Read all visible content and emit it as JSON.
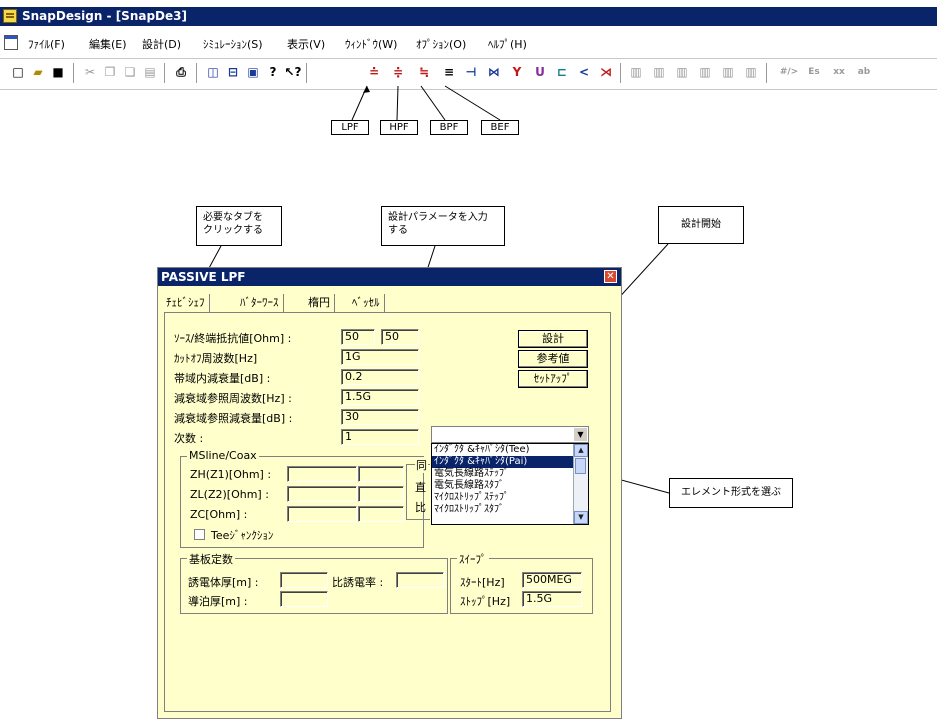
{
  "window": {
    "title": "SnapDesign - [SnapDe3]"
  },
  "menu": [
    "ﾌｧｲﾙ(F)",
    "編集(E)",
    "設計(D)",
    "ｼﾐｭﾚｰｼｮﾝ(S)",
    "表示(V)",
    "ｳｨﾝﾄﾞｳ(W)",
    "ｵﾌﾟｼｮﾝ(O)",
    "ﾍﾙﾌﾟ(H)"
  ],
  "toolbar": {
    "icons": [
      "new-icon",
      "open-icon",
      "save-icon",
      "cut-icon",
      "copy-icon",
      "paste-icon",
      "paste-special-icon",
      "print-icon",
      "layout-vertical-icon",
      "layout-horizontal-icon",
      "cascade-icon",
      "help-icon",
      "context-help-icon",
      "lpf-icon",
      "hpf-icon",
      "bpf-icon",
      "bef-icon",
      "element-1-icon",
      "element-2-icon",
      "element-3-icon",
      "element-4-icon",
      "element-5-icon",
      "element-6-icon",
      "element-7-icon"
    ],
    "greyed_labels": [
      "#/>",
      "Es",
      "xx",
      "ab"
    ]
  },
  "filter_labels": {
    "lpf": "LPF",
    "hpf": "HPF",
    "bpf": "BPF",
    "bef": "BEF"
  },
  "annotations": {
    "tab_hint": [
      "必要なタブを",
      "クリックする"
    ],
    "param_hint": [
      "設計パラメータを入力",
      "する"
    ],
    "start_hint": "設計開始",
    "element_hint": "エレメント形式を選ぶ"
  },
  "dialog": {
    "title": "PASSIVE LPF",
    "tabs": [
      "ﾁｪﾋﾞｼｪﾌ",
      "ﾊﾞﾀｰﾜｰｽ",
      "楕円",
      "ﾍﾞｯｾﾙ"
    ],
    "fields": {
      "source_label": "ｿｰｽ/終端抵抗値[Ohm] :",
      "source_value": "50",
      "load_value": "50",
      "cutoff_label": "ｶｯﾄｵﾌ周波数[Hz]",
      "cutoff_value": "1G",
      "passband_label": "帯域内減衰量[dB] :",
      "passband_value": "0.2",
      "stopfreq_label": "減衰域参照周波数[Hz] :",
      "stopfreq_value": "1.5G",
      "stopatt_label": "減衰域参照減衰量[dB] :",
      "stopatt_value": "30",
      "order_label": "次数 :",
      "order_value": "1"
    },
    "buttons": {
      "design": "設計",
      "reference": "参考値",
      "setup": "ｾｯﾄｱｯﾌﾟ"
    },
    "element_options": [
      "ｲﾝﾀﾞｸﾀ &ｷｬﾊﾟｼﾀ(Tee)",
      "ｲﾝﾀﾞｸﾀ &ｷｬﾊﾟｼﾀ(Pai)",
      "電気長線路ｽﾃｯﾌﾟ",
      "電気長線路ｽﾀﾌﾞ",
      "ﾏｲｸﾛｽﾄﾘｯﾌﾟｽﾃｯﾌﾟ",
      "ﾏｲｸﾛｽﾄﾘｯﾌﾟｽﾀﾌﾞ"
    ],
    "mline": {
      "title": "MSline/Coax",
      "zh_label": "ZH(Z1)[Ohm] :",
      "zl_label": "ZL(Z2)[Ohm] :",
      "zc_label": "ZC[Ohm] :",
      "partial1": "同",
      "partial2": "直",
      "partial3": "比",
      "tee_label": "Teeｼﾞｬﾝｸｼｮﾝ"
    },
    "substrate": {
      "title": "基板定数",
      "thickness_label": "誘電体厚[m] :",
      "permittivity_label": "比誘電率 :",
      "conductor_label": "導泊厚[m] :"
    },
    "sweep": {
      "title": "ｽｲｰﾌﾟ",
      "start_label": "ｽﾀｰﾄ[Hz]",
      "start_value": "500MEG",
      "stop_label": "ｽﾄｯﾌﾟ[Hz]",
      "stop_value": "1.5G"
    }
  }
}
